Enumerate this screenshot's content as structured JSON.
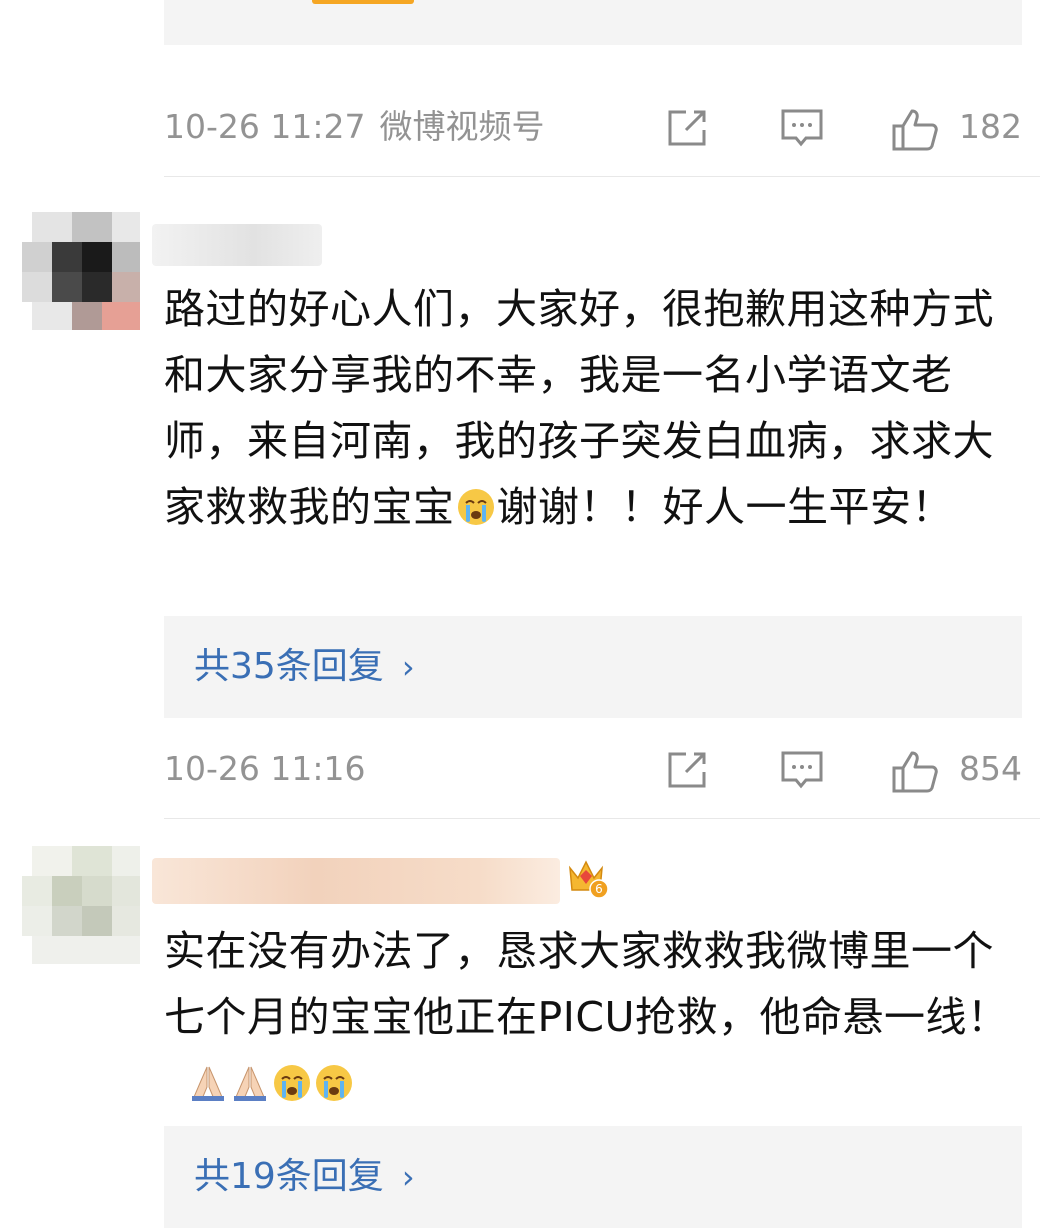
{
  "comments": [
    {
      "meta": {
        "time": "10-26 11:27",
        "source": "微博视频号",
        "likes": "182"
      }
    },
    {
      "text_parts": {
        "before_emoji": "路过的好心人们，大家好，很抱歉用这种方式和大家分享我的不幸，我是一名小学语文老师，来自河南，我的孩子突发白血病，求求大家救救我的宝宝",
        "after_emoji": "谢谢！！好人一生平安！"
      },
      "emoji": "crying-face",
      "replies_label": "共35条回复",
      "meta": {
        "time": "10-26 11:16",
        "source": "",
        "likes": "854"
      }
    },
    {
      "text_parts": {
        "main": "实在没有办法了，恳求大家救救我微博里一个七个月的宝宝他正在PICU抢救，他命悬一线！"
      },
      "emojis": [
        "folded-hands",
        "folded-hands",
        "crying-face",
        "crying-face"
      ],
      "badge": "6",
      "replies_label": "共19条回复"
    }
  ],
  "ui": {
    "reply_chevron": "›"
  },
  "colors": {
    "meta_gray": "#939393",
    "link_blue": "#3a6fb5",
    "reply_bg": "#f4f4f4",
    "text": "#111111"
  }
}
